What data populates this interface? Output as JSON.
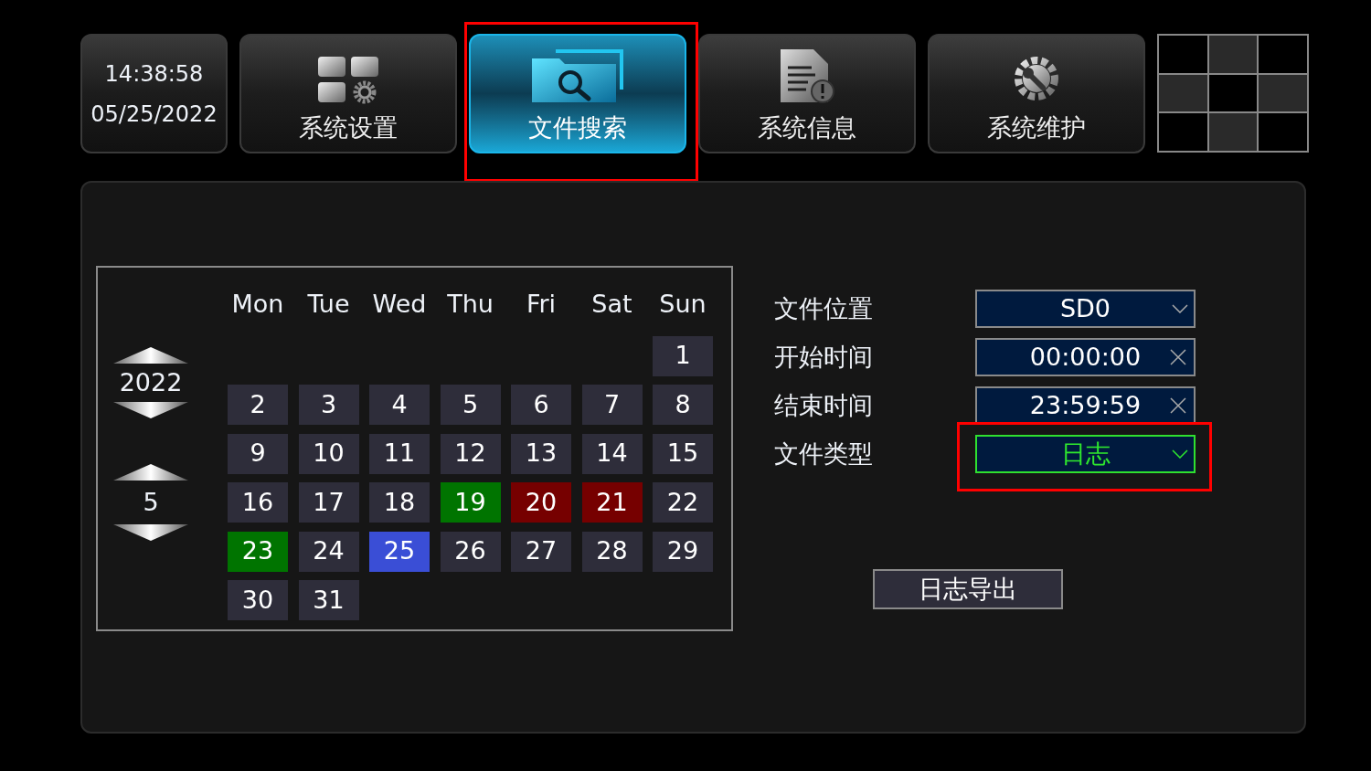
{
  "clock": {
    "time": "14:38:58",
    "date": "05/25/2022"
  },
  "tabs": [
    {
      "label": "系统设置",
      "kind": "settings-tiles",
      "selected": false,
      "highlighted": false
    },
    {
      "label": "文件搜索",
      "kind": "folder-search",
      "selected": true,
      "highlighted": true
    },
    {
      "label": "系统信息",
      "kind": "document-info",
      "selected": false,
      "highlighted": false
    },
    {
      "label": "系统维护",
      "kind": "gear-wrench",
      "selected": false,
      "highlighted": false
    }
  ],
  "calendar": {
    "year": "2022",
    "month": "5",
    "weekdays": [
      "Mon",
      "Tue",
      "Wed",
      "Thu",
      "Fri",
      "Sat",
      "Sun"
    ],
    "days": [
      {
        "label": "1",
        "color": "#2e2d3a"
      },
      {
        "label": "2",
        "color": "#2e2d3a"
      },
      {
        "label": "3",
        "color": "#2e2d3a"
      },
      {
        "label": "4",
        "color": "#2e2d3a"
      },
      {
        "label": "5",
        "color": "#2e2d3a"
      },
      {
        "label": "6",
        "color": "#2e2d3a"
      },
      {
        "label": "7",
        "color": "#2e2d3a"
      },
      {
        "label": "8",
        "color": "#2e2d3a"
      },
      {
        "label": "9",
        "color": "#2e2d3a"
      },
      {
        "label": "10",
        "color": "#2e2d3a"
      },
      {
        "label": "11",
        "color": "#2e2d3a"
      },
      {
        "label": "12",
        "color": "#2e2d3a"
      },
      {
        "label": "13",
        "color": "#2e2d3a"
      },
      {
        "label": "14",
        "color": "#2e2d3a"
      },
      {
        "label": "15",
        "color": "#2e2d3a"
      },
      {
        "label": "16",
        "color": "#2e2d3a"
      },
      {
        "label": "17",
        "color": "#2e2d3a"
      },
      {
        "label": "18",
        "color": "#2e2d3a"
      },
      {
        "label": "19",
        "color": "#007400"
      },
      {
        "label": "20",
        "color": "#760000"
      },
      {
        "label": "21",
        "color": "#760000"
      },
      {
        "label": "22",
        "color": "#2e2d3a"
      },
      {
        "label": "23",
        "color": "#007400"
      },
      {
        "label": "24",
        "color": "#2e2d3a"
      },
      {
        "label": "25",
        "color": "#3a4ed6"
      },
      {
        "label": "26",
        "color": "#2e2d3a"
      },
      {
        "label": "27",
        "color": "#2e2d3a"
      },
      {
        "label": "28",
        "color": "#2e2d3a"
      },
      {
        "label": "29",
        "color": "#2e2d3a"
      },
      {
        "label": "30",
        "color": "#2e2d3a"
      },
      {
        "label": "31",
        "color": "#2e2d3a"
      }
    ]
  },
  "form": [
    {
      "label": "文件位置",
      "value": "SD0",
      "kind": "dropdown",
      "active": false,
      "highlighted": false
    },
    {
      "label": "开始时间",
      "value": "00:00:00",
      "kind": "clearable",
      "active": false,
      "highlighted": false
    },
    {
      "label": "结束时间",
      "value": "23:59:59",
      "kind": "clearable",
      "active": false,
      "highlighted": false
    },
    {
      "label": "文件类型",
      "value": "日志",
      "kind": "dropdown",
      "active": true,
      "highlighted": true
    }
  ],
  "export_button": "日志导出"
}
